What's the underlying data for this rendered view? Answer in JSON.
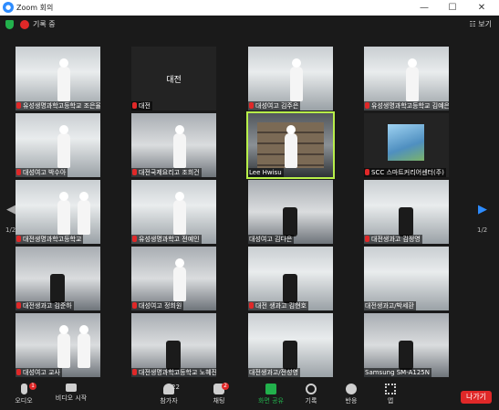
{
  "window": {
    "app_icon": "zoom-logo-icon",
    "title": "Zoom 회의"
  },
  "topbar": {
    "recording_label": "기록 중",
    "view_label": "보기"
  },
  "pagination": {
    "left": "1/2",
    "right": "1/2"
  },
  "tiles": [
    {
      "name": "유성생명과학고등학교 조은율",
      "muted": true,
      "bg": "lane-light",
      "people": 1
    },
    {
      "name": "대전",
      "muted": true,
      "bg": "blank",
      "big": "대전"
    },
    {
      "name": "대성여고 김주은",
      "muted": true,
      "bg": "lane-light",
      "people": 1
    },
    {
      "name": "유성생명과학고등학교 김예은",
      "muted": true,
      "bg": "lane-light",
      "people": 1
    },
    {
      "name": "대성여고 박수아",
      "muted": true,
      "bg": "lane-light",
      "people": 1
    },
    {
      "name": "대전국제요리고 조희건",
      "muted": true,
      "bg": "lane-mid",
      "people": 1
    },
    {
      "name": "Lee Hwisu",
      "muted": false,
      "bg": "lane-dark",
      "shelf": true,
      "active": true
    },
    {
      "name": "SCC 스마트커리어센터(주)",
      "muted": true,
      "bg": "blank",
      "poster": true
    },
    {
      "name": "대전생명과학고등학교",
      "muted": true,
      "bg": "lane-light",
      "people": 2
    },
    {
      "name": "유성생명과학고 전예인",
      "muted": true,
      "bg": "lane-light",
      "people": 1
    },
    {
      "name": "대성여고 김다은",
      "muted": false,
      "bg": "lane-mid",
      "apron": true
    },
    {
      "name": "대전생과고 김정영",
      "muted": true,
      "bg": "lane-light",
      "apron": true
    },
    {
      "name": "대전생과고 김준하",
      "muted": true,
      "bg": "lane-mid",
      "apron": true
    },
    {
      "name": "대성여고 정희원",
      "muted": true,
      "bg": "lane-mid",
      "people": 1
    },
    {
      "name": "대전 생과고 김현호",
      "muted": true,
      "bg": "lane-light",
      "apron": true
    },
    {
      "name": "대전생과고/박세환",
      "muted": false,
      "bg": "lane-light",
      "people": 0
    },
    {
      "name": "대성여고 교사",
      "muted": true,
      "bg": "lane-mid",
      "people": 2
    },
    {
      "name": "대전생명과학고등학교 노혜진",
      "muted": true,
      "bg": "lane-mid",
      "apron": true
    },
    {
      "name": "대전생과고/전성영",
      "muted": false,
      "bg": "lane-light",
      "apron": true
    },
    {
      "name": "Samsung SM-A125N",
      "muted": false,
      "bg": "lane-mid",
      "apron": true
    }
  ],
  "toolbar": {
    "audio": {
      "label": "오디오",
      "badge": "1",
      "icon": "microphone-icon"
    },
    "video": {
      "label": "비디오 시작",
      "icon": "camera-icon"
    },
    "participants": {
      "label": "참가자",
      "count": "22",
      "icon": "participants-icon"
    },
    "chat": {
      "label": "채팅",
      "badge": "2",
      "icon": "chat-icon"
    },
    "share": {
      "label": "화면 공유",
      "icon": "share-screen-icon",
      "color": "#22b14c"
    },
    "record": {
      "label": "기록",
      "icon": "record-icon"
    },
    "reactions": {
      "label": "반응",
      "icon": "reactions-icon"
    },
    "apps": {
      "label": "앱",
      "icon": "apps-icon"
    },
    "leave": {
      "label": "나가기",
      "color": "#e02828"
    }
  }
}
